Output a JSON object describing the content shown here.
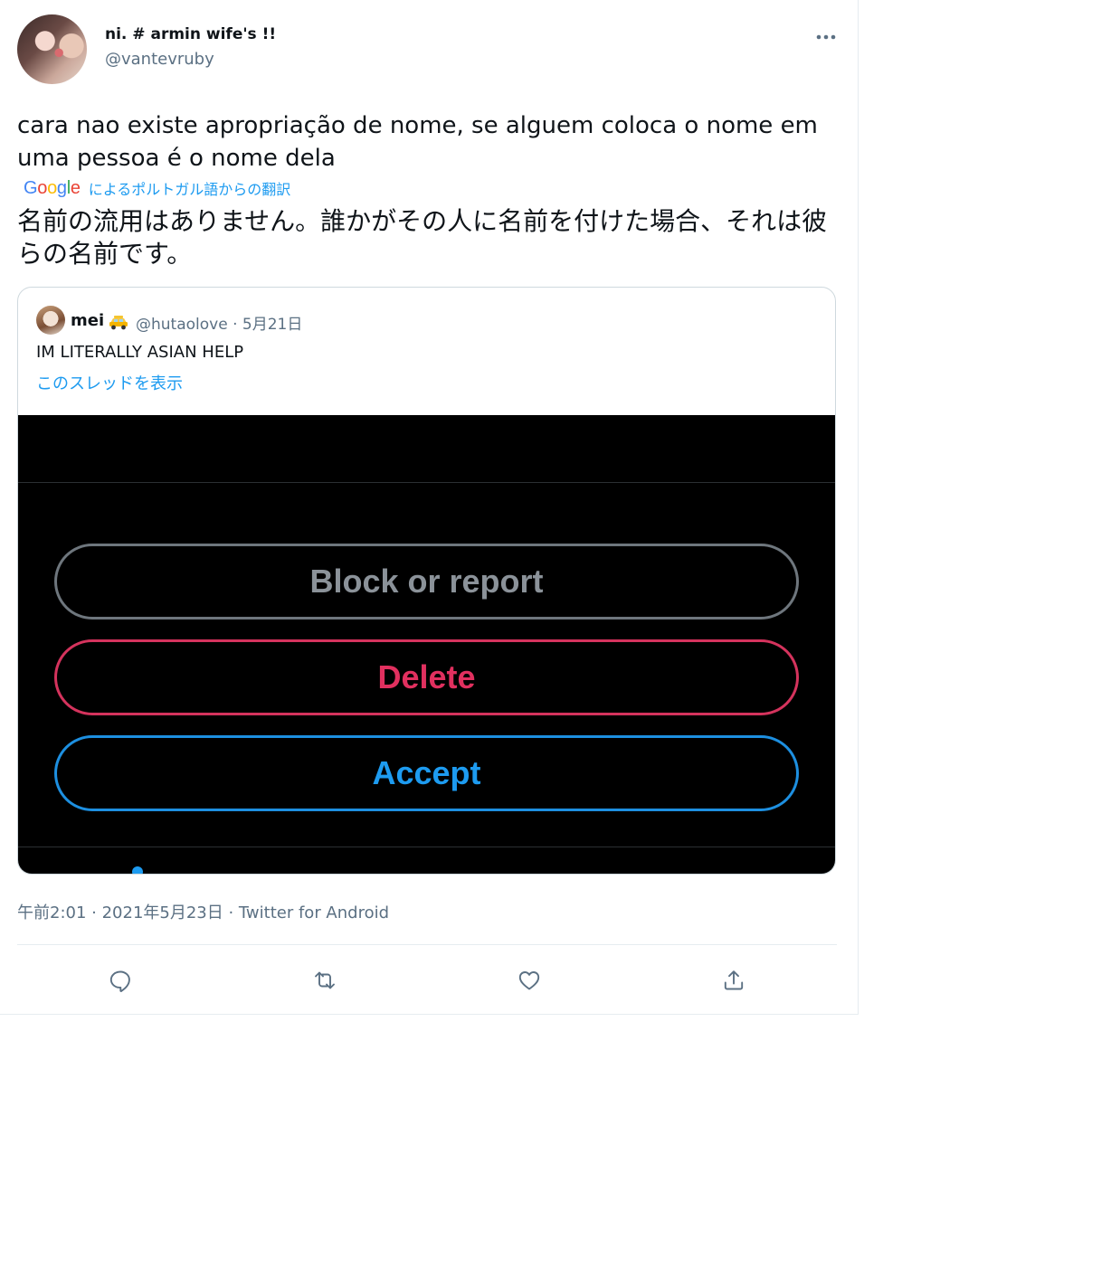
{
  "author": {
    "display_name": "ni. # armin wife's !!",
    "handle": "@vantevruby"
  },
  "tweet": {
    "text": "cara nao existe apropriação de nome, se alguem coloca o nome em uma pessoa é o nome dela",
    "translation_source": "Google",
    "translation_label": "によるポルトガル語からの翻訳",
    "translated_text": "名前の流用はありません。誰かがその人に名前を付けた場合、それは彼らの名前です。",
    "timestamp": "午前2:01 · 2021年5月23日 · Twitter for Android"
  },
  "quoted_tweet": {
    "display_name": "mei",
    "emoji": "taxi-emoji",
    "meta": "@hutaolove · 5月21日",
    "text": "IM LITERALLY ASIAN HELP",
    "show_thread": "このスレッドを表示",
    "media_buttons": {
      "block": "Block or report",
      "delete": "Delete",
      "accept": "Accept"
    }
  },
  "actions": [
    "reply-icon",
    "retweet-icon",
    "like-icon",
    "share-icon"
  ],
  "colors": {
    "link": "#1d9bf0",
    "secondary_text": "#5b7083",
    "delete_red": "#e1305f",
    "accept_blue": "#1d9bf0",
    "google": [
      "#4285f4",
      "#ea4335",
      "#fbbc05",
      "#34a853"
    ]
  }
}
